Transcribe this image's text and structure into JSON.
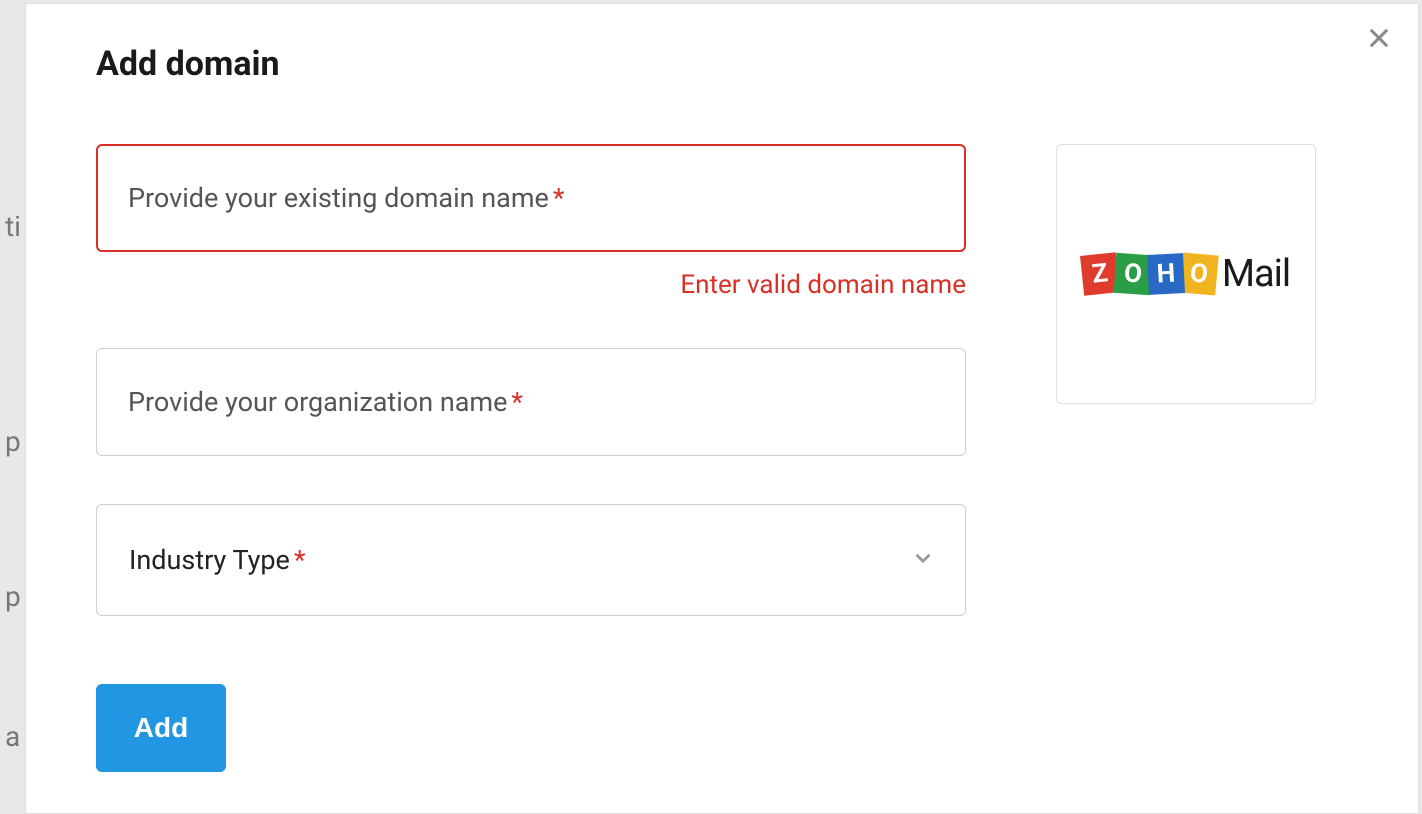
{
  "modal": {
    "title": "Add domain"
  },
  "form": {
    "domain": {
      "placeholder": "Provide your existing domain name",
      "error": "Enter valid domain name",
      "required_marker": "*"
    },
    "organization": {
      "placeholder": "Provide your organization name",
      "required_marker": "*"
    },
    "industry": {
      "label": "Industry Type",
      "required_marker": "*"
    },
    "submit_label": "Add"
  },
  "logo": {
    "letters": [
      "Z",
      "O",
      "H",
      "O"
    ],
    "suffix": "Mail"
  },
  "behind": {
    "t1": "ti",
    "t2": "p",
    "t3": "p",
    "t4": "a"
  }
}
